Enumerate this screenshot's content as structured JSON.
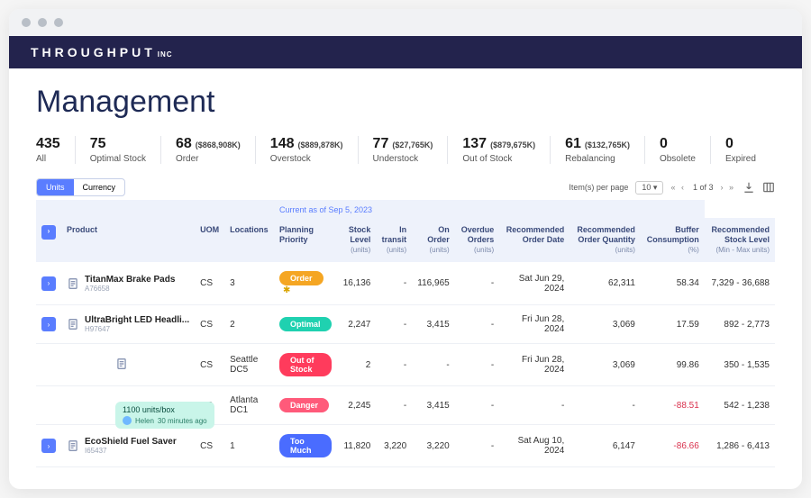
{
  "brand": {
    "name": "THROUGHPUT",
    "suffix": "INC"
  },
  "page_title": "Management",
  "kpis": [
    {
      "value": "435",
      "sub": "",
      "label": "All"
    },
    {
      "value": "75",
      "sub": "",
      "label": "Optimal Stock"
    },
    {
      "value": "68",
      "sub": "($868,908K)",
      "label": "Order"
    },
    {
      "value": "148",
      "sub": "($889,878K)",
      "label": "Overstock"
    },
    {
      "value": "77",
      "sub": "($27,765K)",
      "label": "Understock"
    },
    {
      "value": "137",
      "sub": "($879,675K)",
      "label": "Out of Stock"
    },
    {
      "value": "61",
      "sub": "($132,765K)",
      "label": "Rebalancing"
    },
    {
      "value": "0",
      "sub": "",
      "label": "Obsolete"
    },
    {
      "value": "0",
      "sub": "",
      "label": "Expired"
    }
  ],
  "toggle": {
    "units": "Units",
    "currency": "Currency"
  },
  "pager": {
    "label": "Item(s) per page",
    "size": "10",
    "pos": "1 of 3",
    "nav": "«  ‹  ›  »"
  },
  "asof": "Current as of Sep 5, 2023",
  "headers": {
    "product": "Product",
    "uom": "UOM",
    "locations": "Locations",
    "priority": "Planning Priority",
    "stock": "Stock Level",
    "transit": "In transit",
    "onorder": "On Order",
    "overdue": "Overdue Orders",
    "recdate": "Recommended Order Date",
    "recqty": "Recommended Order Quantity",
    "buffer": "Buffer Consumption",
    "reclevel": "Recommended Stock Level",
    "u_units": "(units)",
    "u_pct": "(%)",
    "u_range": "(Min - Max units)"
  },
  "rows": [
    {
      "expand": true,
      "icon": true,
      "name": "TitanMax Brake Pads",
      "sku": "A76658",
      "uom": "CS",
      "loc": "3",
      "priority": "Order",
      "pclass": "order",
      "star": true,
      "stock": "16,136",
      "transit": "-",
      "onorder": "116,965",
      "overdue": "-",
      "recdate": "Sat Jun 29, 2024",
      "recqty": "62,311",
      "buffer": "58.34",
      "bneg": false,
      "range": "7,329 - 36,688"
    },
    {
      "expand": true,
      "icon": true,
      "name": "UltraBright LED Headli...",
      "sku": "H97647",
      "uom": "CS",
      "loc": "2",
      "priority": "Optimal",
      "pclass": "optimal",
      "star": false,
      "stock": "2,247",
      "transit": "-",
      "onorder": "3,415",
      "overdue": "-",
      "recdate": "Fri Jun 28, 2024",
      "recqty": "3,069",
      "buffer": "17.59",
      "bneg": false,
      "range": "892 - 2,773"
    },
    {
      "expand": false,
      "icon": true,
      "name": "",
      "sku": "",
      "uom": "CS",
      "loc": "Seattle DC5",
      "priority": "Out of Stock",
      "pclass": "oos",
      "star": false,
      "stock": "2",
      "transit": "-",
      "onorder": "-",
      "overdue": "-",
      "recdate": "Fri Jun 28, 2024",
      "recqty": "3,069",
      "buffer": "99.86",
      "bneg": false,
      "range": "350 - 1,535",
      "indent": true
    },
    {
      "expand": false,
      "icon": false,
      "name": "",
      "sku": "",
      "uom": "CS",
      "loc": "Atlanta DC1",
      "priority": "Danger",
      "pclass": "danger",
      "star": false,
      "stock": "2,245",
      "transit": "-",
      "onorder": "3,415",
      "overdue": "-",
      "recdate": "-",
      "recqty": "-",
      "buffer": "-88.51",
      "bneg": true,
      "range": "542 - 1,238",
      "indent": true,
      "annot": {
        "text": "1100 units/box",
        "who": "Helen",
        "when": "30 minutes ago"
      }
    },
    {
      "expand": true,
      "icon": true,
      "name": "EcoShield Fuel Saver",
      "sku": "I65437",
      "uom": "CS",
      "loc": "1",
      "priority": "Too Much",
      "pclass": "toomuch",
      "star": false,
      "stock": "11,820",
      "transit": "3,220",
      "onorder": "3,220",
      "overdue": "-",
      "recdate": "Sat Aug 10, 2024",
      "recqty": "6,147",
      "buffer": "-86.66",
      "bneg": true,
      "range": "1,286 - 6,413"
    }
  ]
}
